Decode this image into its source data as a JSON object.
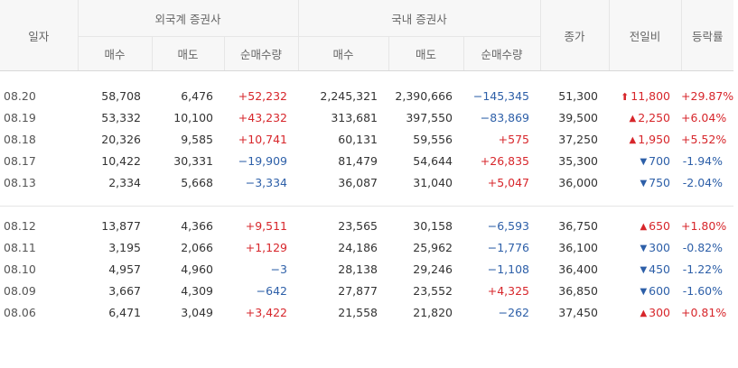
{
  "header": {
    "date": "일자",
    "foreign": "외국계 증권사",
    "domestic": "국내 증권사",
    "close": "종가",
    "change": "전일비",
    "rate": "등락률",
    "buy": "매수",
    "sell": "매도",
    "net": "순매수량"
  },
  "rows": [
    {
      "date": "08.20",
      "f_buy": "58,708",
      "f_sell": "6,476",
      "f_net": "+52,232",
      "d_buy": "2,245,321",
      "d_sell": "2,390,666",
      "d_net": "−145,345",
      "close": "51,300",
      "chg": "11,800",
      "chg_dir": "upper-limit",
      "rate": "+29.87%"
    },
    {
      "date": "08.19",
      "f_buy": "53,332",
      "f_sell": "10,100",
      "f_net": "+43,232",
      "d_buy": "313,681",
      "d_sell": "397,550",
      "d_net": "−83,869",
      "close": "39,500",
      "chg": "2,250",
      "chg_dir": "up",
      "rate": "+6.04%"
    },
    {
      "date": "08.18",
      "f_buy": "20,326",
      "f_sell": "9,585",
      "f_net": "+10,741",
      "d_buy": "60,131",
      "d_sell": "59,556",
      "d_net": "+575",
      "close": "37,250",
      "chg": "1,950",
      "chg_dir": "up",
      "rate": "+5.52%"
    },
    {
      "date": "08.17",
      "f_buy": "10,422",
      "f_sell": "30,331",
      "f_net": "−19,909",
      "d_buy": "81,479",
      "d_sell": "54,644",
      "d_net": "+26,835",
      "close": "35,300",
      "chg": "700",
      "chg_dir": "down",
      "rate": "-1.94%"
    },
    {
      "date": "08.13",
      "f_buy": "2,334",
      "f_sell": "5,668",
      "f_net": "−3,334",
      "d_buy": "36,087",
      "d_sell": "31,040",
      "d_net": "+5,047",
      "close": "36,000",
      "chg": "750",
      "chg_dir": "down",
      "rate": "-2.04%"
    },
    {
      "date": "08.12",
      "f_buy": "13,877",
      "f_sell": "4,366",
      "f_net": "+9,511",
      "d_buy": "23,565",
      "d_sell": "30,158",
      "d_net": "−6,593",
      "close": "36,750",
      "chg": "650",
      "chg_dir": "up",
      "rate": "+1.80%"
    },
    {
      "date": "08.11",
      "f_buy": "3,195",
      "f_sell": "2,066",
      "f_net": "+1,129",
      "d_buy": "24,186",
      "d_sell": "25,962",
      "d_net": "−1,776",
      "close": "36,100",
      "chg": "300",
      "chg_dir": "down",
      "rate": "-0.82%"
    },
    {
      "date": "08.10",
      "f_buy": "4,957",
      "f_sell": "4,960",
      "f_net": "−3",
      "d_buy": "28,138",
      "d_sell": "29,246",
      "d_net": "−1,108",
      "close": "36,400",
      "chg": "450",
      "chg_dir": "down",
      "rate": "-1.22%"
    },
    {
      "date": "08.09",
      "f_buy": "3,667",
      "f_sell": "4,309",
      "f_net": "−642",
      "d_buy": "27,877",
      "d_sell": "23,552",
      "d_net": "+4,325",
      "close": "36,850",
      "chg": "600",
      "chg_dir": "down",
      "rate": "-1.60%"
    },
    {
      "date": "08.06",
      "f_buy": "6,471",
      "f_sell": "3,049",
      "f_net": "+3,422",
      "d_buy": "21,558",
      "d_sell": "21,820",
      "d_net": "−262",
      "close": "37,450",
      "chg": "300",
      "chg_dir": "up",
      "rate": "+0.81%"
    }
  ],
  "colors": {
    "up": "#d7262b",
    "down": "#2d5fa8",
    "header_bg": "#f7f7f7",
    "border": "#e6e6e6"
  }
}
